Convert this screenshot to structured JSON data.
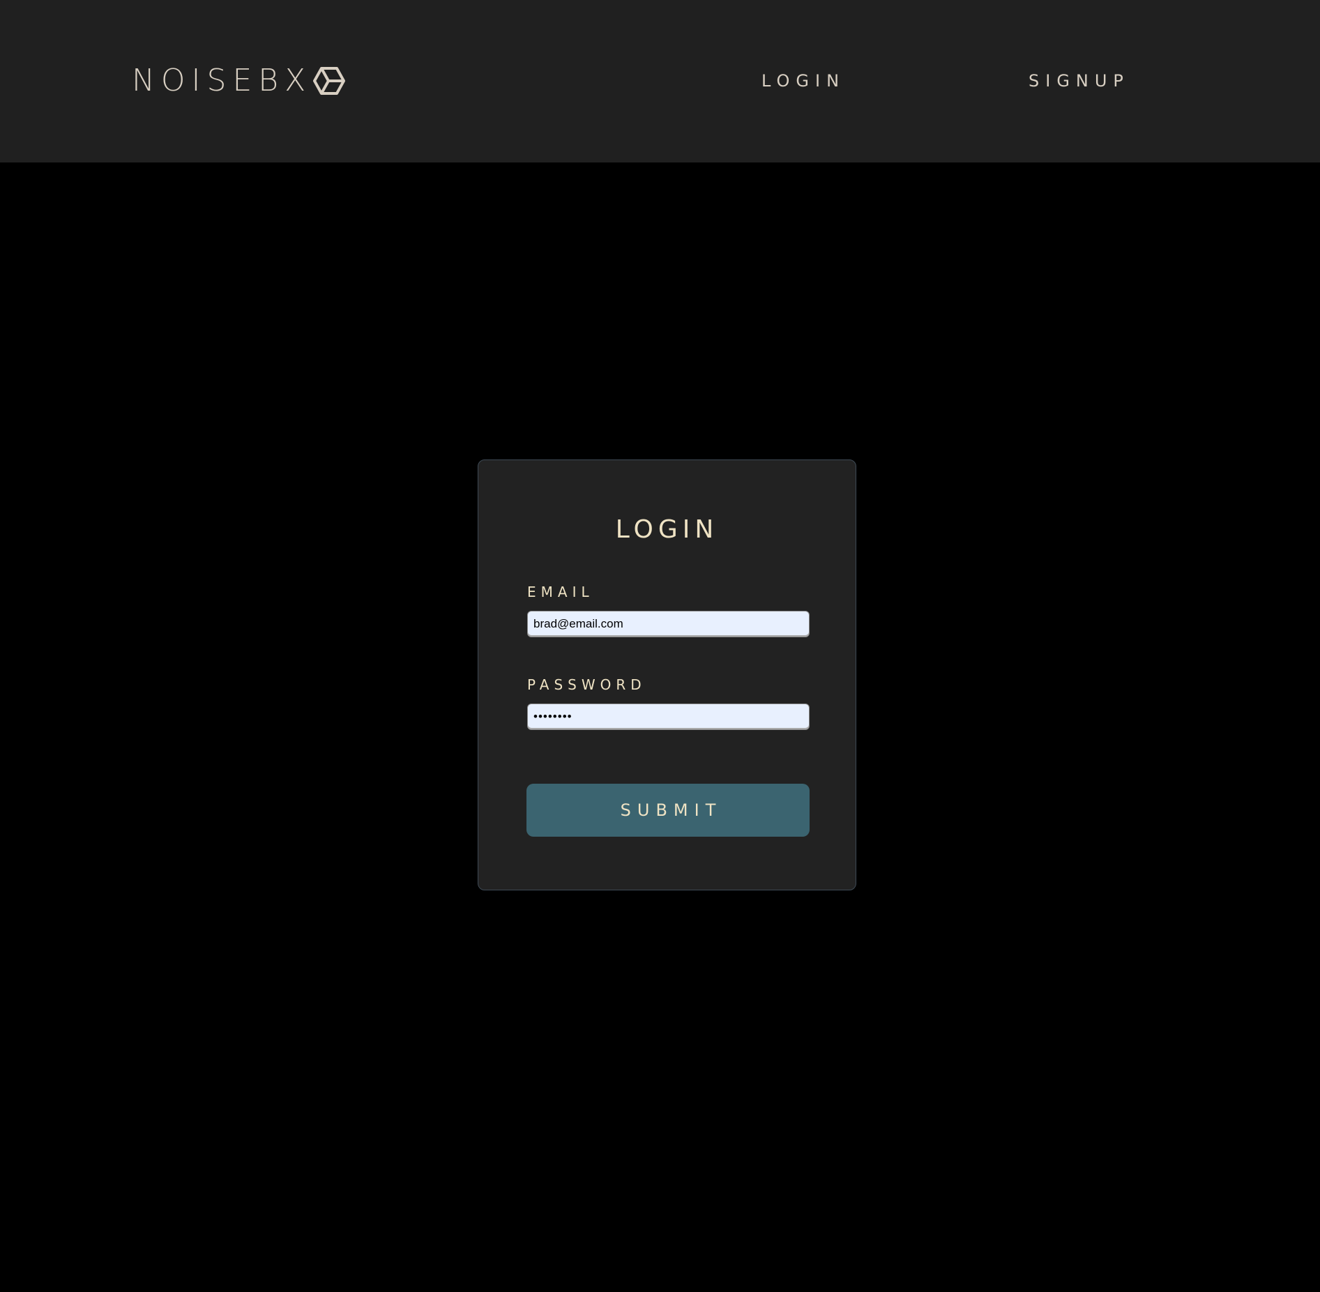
{
  "header": {
    "brand": "NOISEBX",
    "brand_icon": "hexagon-cube-icon",
    "nav": {
      "login_label": "LOGIN",
      "signup_label": "SIGNUP"
    }
  },
  "login_form": {
    "title": "LOGIN",
    "email": {
      "label": "EMAIL",
      "value": "brad@email.com"
    },
    "password": {
      "label": "PASSWORD",
      "value": "••••••••"
    },
    "submit_label": "SUBMIT"
  },
  "colors": {
    "page_background": "#000000",
    "navbar_background": "#202020",
    "card_background": "#222222",
    "accent_text": "#efe3c4",
    "nav_text": "#d8cfc2",
    "input_background": "#e8f0fe",
    "submit_background": "#3b6470"
  }
}
